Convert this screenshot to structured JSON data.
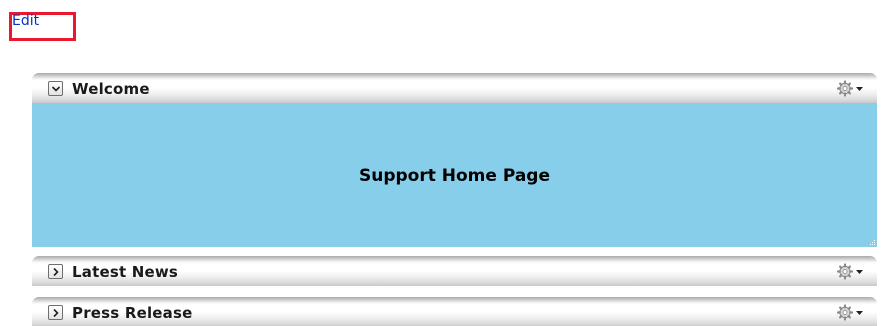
{
  "toolbar": {
    "edit_label": "Edit"
  },
  "panels": [
    {
      "title": "Welcome",
      "state": "expanded",
      "toggle_icon": "chevron-down-icon",
      "menu_icon": "gear-icon",
      "body_text": "Support Home Page"
    },
    {
      "title": "Latest News",
      "state": "collapsed",
      "toggle_icon": "chevron-right-icon",
      "menu_icon": "gear-icon"
    },
    {
      "title": "Press Release",
      "state": "collapsed",
      "toggle_icon": "chevron-right-icon",
      "menu_icon": "gear-icon"
    }
  ],
  "colors": {
    "link": "#0033cc",
    "highlight_border": "#e8192c",
    "welcome_body": "#87ceeb"
  }
}
